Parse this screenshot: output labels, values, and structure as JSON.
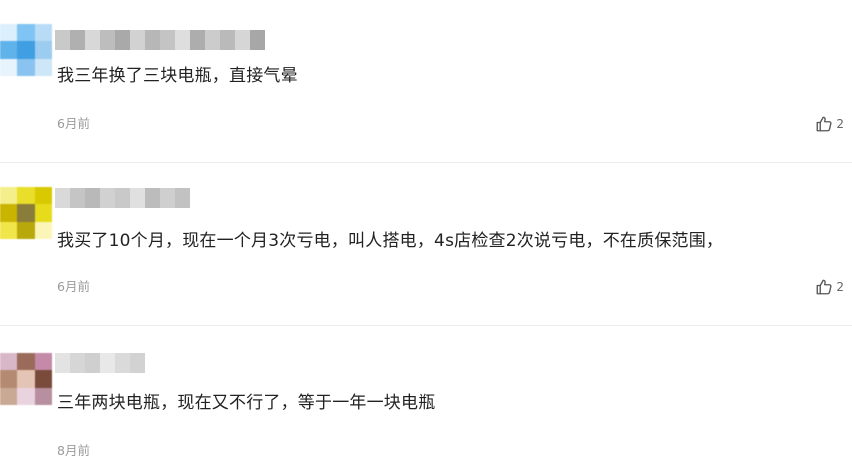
{
  "comments": [
    {
      "text": "我三年换了三块电瓶，直接气晕",
      "time": "6月前",
      "likes": "2",
      "avatar_colors": [
        "#dceffc",
        "#7fc4f2",
        "#b8dcf6",
        "#5fb2ea",
        "#3f9fe2",
        "#9ccdf0",
        "#e8f4fd",
        "#8ac3ef",
        "#cde6f8"
      ],
      "name_colors": [
        "#c9c9c9",
        "#b0b0b0",
        "#d8d8d8",
        "#bdbdbd",
        "#a9a9a9",
        "#d2d2d2",
        "#b7b7b7",
        "#c4c4c4",
        "#dedede",
        "#adadad",
        "#cccccc",
        "#bababa",
        "#d6d6d6",
        "#a7a7a7"
      ]
    },
    {
      "text": "我买了10个月，现在一个月3次亏电，叫人搭电，4s店检查2次说亏电，不在质保范围，",
      "time": "6月前",
      "likes": "2",
      "avatar_colors": [
        "#f4ef8a",
        "#e9df2a",
        "#d9c900",
        "#c9b400",
        "#8a7c3a",
        "#e6dc1c",
        "#f0e64a",
        "#b8a80c",
        "#fbf6b8"
      ],
      "name_colors": [
        "#d9d9d9",
        "#c5c5c5",
        "#b9b9b9",
        "#d1d1d1",
        "#c9c9c9",
        "#e0e0e0",
        "#bcbcbc",
        "#cfcfcf",
        "#c2c2c2"
      ]
    },
    {
      "text": "三年两块电瓶，现在又不行了，等于一年一块电瓶",
      "time": "8月前",
      "likes": "",
      "avatar_colors": [
        "#d8b8c8",
        "#9a6a5a",
        "#c48aa8",
        "#b58a72",
        "#e4c4b4",
        "#7a4a3a",
        "#c9a894",
        "#e9d3df",
        "#b88f9f"
      ],
      "name_colors": [
        "#e3e3e3",
        "#d6d6d6",
        "#cfcfcf",
        "#e8e8e8",
        "#dadada",
        "#d2d2d2"
      ]
    }
  ]
}
